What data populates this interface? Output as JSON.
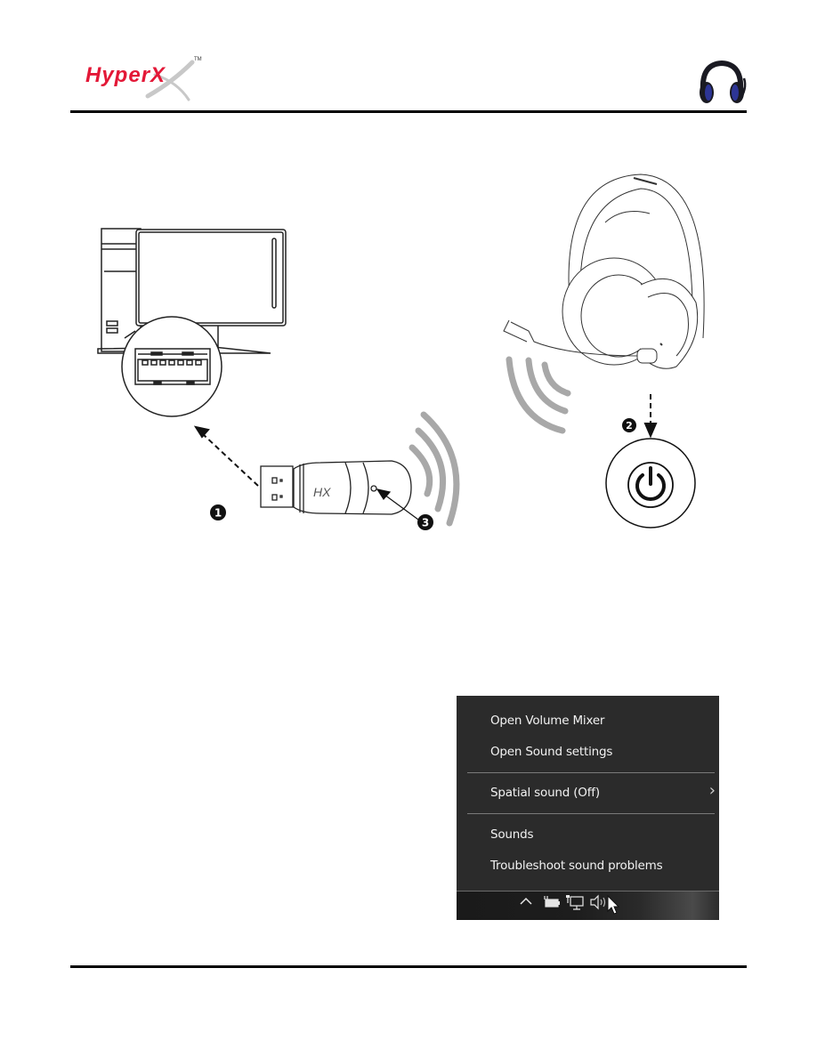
{
  "header": {
    "brand_logo": "HyperX",
    "trademark": "TM",
    "product_icon": "headset-icon"
  },
  "diagram": {
    "steps": [
      {
        "number": "1",
        "description": "Insert USB wireless adapter into PC USB port"
      },
      {
        "number": "2",
        "description": "Power on headset"
      },
      {
        "number": "3",
        "description": "Adapter LED indicator"
      }
    ],
    "adapter_brand_mark": "HX",
    "icons": [
      "pc-tower-icon",
      "monitor-icon",
      "usb-port-zoom-icon",
      "usb-adapter-icon",
      "wireless-signal-icon",
      "headset-icon",
      "power-button-icon"
    ]
  },
  "context_menu": {
    "items": [
      {
        "label": "Open Volume Mixer"
      },
      {
        "label": "Open Sound settings"
      },
      {
        "label": "Spatial sound (Off)",
        "has_submenu": true
      },
      {
        "label": "Sounds"
      },
      {
        "label": "Troubleshoot sound problems"
      }
    ],
    "submenu_chevron": "›"
  },
  "taskbar": {
    "tray_icons": [
      "chevron-up-icon",
      "battery-icon",
      "network-icon",
      "volume-icon",
      "mouse-cursor-icon"
    ]
  },
  "colors": {
    "brand_red": "#e31837",
    "menu_bg": "#2b2b2b",
    "menu_text": "#f2f2f2",
    "wave_gray": "#a8a8a8"
  }
}
